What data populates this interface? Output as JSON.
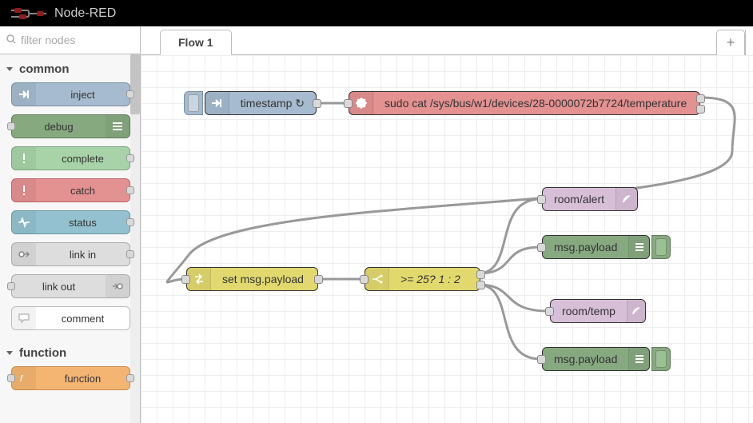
{
  "app_title": "Node-RED",
  "filter_placeholder": "filter nodes",
  "categories": [
    {
      "id": "common",
      "label": "common",
      "nodes": [
        {
          "id": "inject",
          "label": "inject",
          "color": "c-inject",
          "icon": "arrow-in",
          "icon_side": "left",
          "port_left": false,
          "port_right": true
        },
        {
          "id": "debug",
          "label": "debug",
          "color": "c-debug",
          "icon": "bars",
          "icon_side": "right",
          "port_left": true,
          "port_right": false
        },
        {
          "id": "complete",
          "label": "complete",
          "color": "c-complete",
          "icon": "bang",
          "icon_side": "left",
          "port_left": false,
          "port_right": true
        },
        {
          "id": "catch",
          "label": "catch",
          "color": "c-catch",
          "icon": "bang",
          "icon_side": "left",
          "port_left": false,
          "port_right": true
        },
        {
          "id": "status",
          "label": "status",
          "color": "c-status",
          "icon": "pulse",
          "icon_side": "left",
          "port_left": false,
          "port_right": true
        },
        {
          "id": "link-in",
          "label": "link in",
          "color": "c-link",
          "icon": "link-in",
          "icon_side": "left",
          "port_left": false,
          "port_right": true
        },
        {
          "id": "link-out",
          "label": "link out",
          "color": "c-link",
          "icon": "link-out",
          "icon_side": "right",
          "port_left": true,
          "port_right": false
        },
        {
          "id": "comment",
          "label": "comment",
          "color": "c-comment",
          "icon": "comment",
          "icon_side": "left",
          "port_left": false,
          "port_right": false
        }
      ]
    },
    {
      "id": "function",
      "label": "function",
      "nodes": [
        {
          "id": "function",
          "label": "function",
          "color": "c-function",
          "icon": "fx",
          "icon_side": "left",
          "port_left": true,
          "port_right": true
        }
      ]
    }
  ],
  "tabs": {
    "active": "Flow 1"
  },
  "flow_nodes": {
    "inject": {
      "label": "timestamp ↻"
    },
    "exec": {
      "label": "sudo cat /sys/bus/w1/devices/28-0000072b7724/temperature"
    },
    "change": {
      "label": "set msg.payload"
    },
    "switch": {
      "label": ">= 25? 1 : 2"
    },
    "mqtt_alert": {
      "label": "room/alert"
    },
    "debug1": {
      "label": "msg.payload"
    },
    "mqtt_temp": {
      "label": "room/temp"
    },
    "debug2": {
      "label": "msg.payload"
    }
  }
}
